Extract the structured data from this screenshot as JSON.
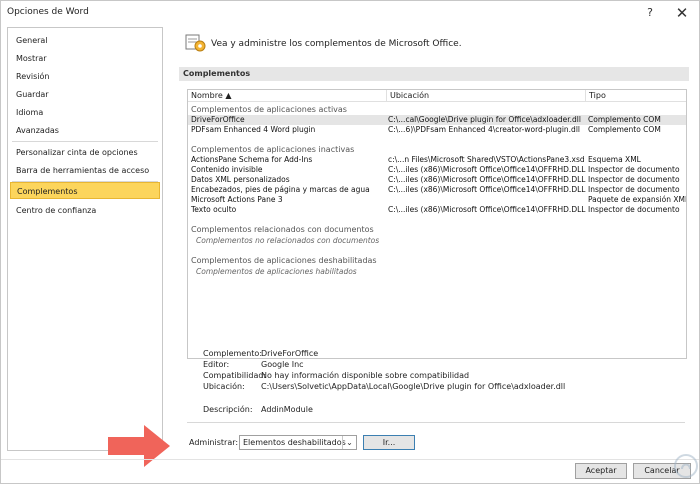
{
  "window": {
    "title": "Opciones de Word",
    "help_glyph": "?",
    "close_glyph": "✕"
  },
  "sidebar": {
    "items": [
      {
        "label": "General"
      },
      {
        "label": "Mostrar"
      },
      {
        "label": "Revisión"
      },
      {
        "label": "Guardar"
      },
      {
        "label": "Idioma"
      },
      {
        "label": "Avanzadas"
      },
      {
        "label": "Personalizar cinta de opciones"
      },
      {
        "label": "Barra de herramientas de acceso rápido"
      },
      {
        "label": "Complementos"
      },
      {
        "label": "Centro de confianza"
      }
    ],
    "active_index": 8
  },
  "header": {
    "text": "Vea y administre los complementos de Microsoft Office.",
    "icon": "addin-gear-icon"
  },
  "section": {
    "title": "Complementos"
  },
  "list": {
    "columns": [
      "Nombre ▲",
      "Ubicación",
      "Tipo"
    ],
    "groups": [
      {
        "label": "Complementos de aplicaciones activas",
        "rows": [
          {
            "name": "DriveForOffice",
            "location": "C:\\...cal\\Google\\Drive plugin for Office\\adxloader.dll",
            "type": "Complemento COM",
            "selected": true
          },
          {
            "name": "PDFsam Enhanced 4 Word plugin",
            "location": "C:\\...6)\\PDFsam Enhanced 4\\creator-word-plugin.dll",
            "type": "Complemento COM"
          }
        ]
      },
      {
        "label": "Complementos de aplicaciones inactivas",
        "rows": [
          {
            "name": "ActionsPane Schema for Add-Ins",
            "location": "c:\\...n Files\\Microsoft Shared\\VSTO\\ActionsPane3.xsd",
            "type": "Esquema XML"
          },
          {
            "name": "Contenido invisible",
            "location": "C:\\...iles (x86)\\Microsoft Office\\Office14\\OFFRHD.DLL",
            "type": "Inspector de documento"
          },
          {
            "name": "Datos XML personalizados",
            "location": "C:\\...iles (x86)\\Microsoft Office\\Office14\\OFFRHD.DLL",
            "type": "Inspector de documento"
          },
          {
            "name": "Encabezados, pies de página y marcas de agua",
            "location": "C:\\...iles (x86)\\Microsoft Office\\Office14\\OFFRHD.DLL",
            "type": "Inspector de documento"
          },
          {
            "name": "Microsoft Actions Pane 3",
            "location": "",
            "type": "Paquete de expansión XML"
          },
          {
            "name": "Texto oculto",
            "location": "C:\\...iles (x86)\\Microsoft Office\\Office14\\OFFRHD.DLL",
            "type": "Inspector de documento"
          }
        ]
      },
      {
        "label": "Complementos relacionados con documentos",
        "empty": "Complementos no relacionados con documentos"
      },
      {
        "label": "Complementos de aplicaciones deshabilitadas",
        "empty": "Complementos de aplicaciones habilitados"
      }
    ]
  },
  "details": {
    "complemento_label": "Complemento:",
    "complemento": "DriveForOffice",
    "editor_label": "Editor:",
    "editor": "Google Inc",
    "compat_label": "Compatibilidad:",
    "compat": "No hay información disponible sobre compatibilidad",
    "location_label": "Ubicación:",
    "location": "C:\\Users\\Solvetic\\AppData\\Local\\Google\\Drive plugin for Office\\adxloader.dll",
    "desc_label": "Descripción:",
    "desc": "AddinModule"
  },
  "manage": {
    "label": "Administrar:",
    "selected": "Elementos deshabilitados",
    "go_label": "Ir..."
  },
  "footer": {
    "ok_label": "Aceptar",
    "cancel_label": "Cancelar"
  },
  "colors": {
    "active_nav": "#fcd55c",
    "arrow": "#f0645a",
    "go_border": "#3c7fb1"
  }
}
